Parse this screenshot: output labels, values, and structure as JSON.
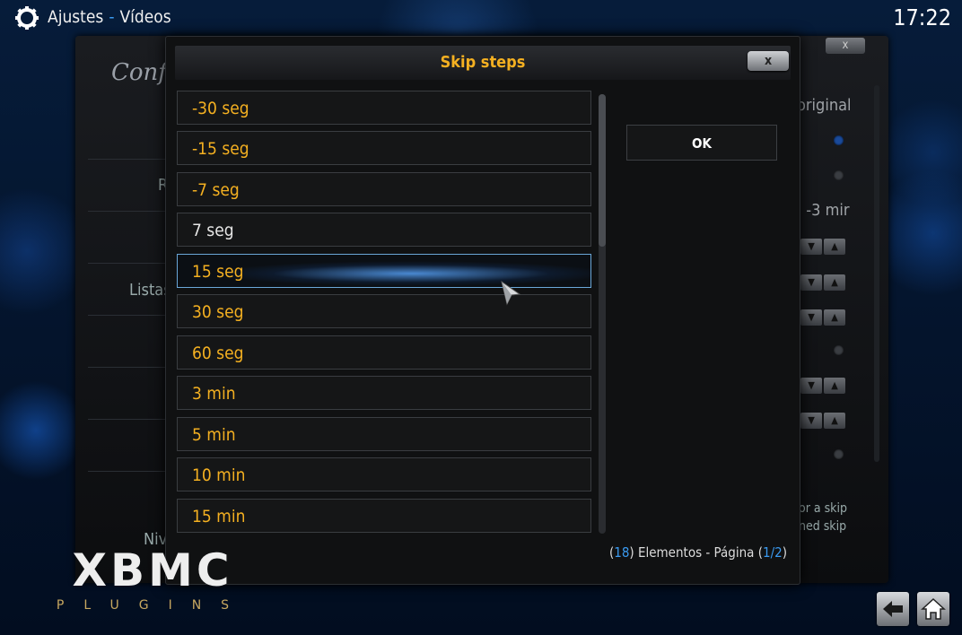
{
  "header": {
    "section": "Ajustes",
    "separator": "-",
    "subsection": "Vídeos",
    "time": "17:22"
  },
  "background_window": {
    "logo_text": "Conf",
    "left_labels": [
      "R",
      "Listas",
      "Niv"
    ],
    "right_texts": {
      "original": "original",
      "skip_value": ", -3 mir",
      "desc_line1": "or a skip",
      "desc_line2": "ned skip"
    },
    "close_label": "x"
  },
  "dialog": {
    "title": "Skip steps",
    "close_label": "x",
    "ok_label": "OK",
    "items": [
      {
        "label": "-30 seg",
        "state": "selected"
      },
      {
        "label": "-15 seg",
        "state": "selected"
      },
      {
        "label": "-7 seg",
        "state": "selected"
      },
      {
        "label": "7 seg",
        "state": "unselected"
      },
      {
        "label": "15 seg",
        "state": "focused"
      },
      {
        "label": "30 seg",
        "state": "selected"
      },
      {
        "label": "60 seg",
        "state": "selected"
      },
      {
        "label": "3 min",
        "state": "selected"
      },
      {
        "label": "5 min",
        "state": "selected"
      },
      {
        "label": "10 min",
        "state": "selected"
      },
      {
        "label": "15 min",
        "state": "selected"
      }
    ],
    "footer": {
      "open_paren": "(",
      "count": "18",
      "elements_text": ") Elementos - Página (",
      "page": "1/2",
      "close_paren": ")"
    }
  },
  "branding": {
    "logo_main": "XBMC",
    "logo_sub": "PLUGINS"
  },
  "colors": {
    "accent_orange": "#f4b021",
    "accent_blue": "#3a9af0",
    "panel_bg": "#101112"
  },
  "icons": {
    "settings": "gear-icon",
    "back": "back-arrow-icon",
    "home": "home-icon",
    "pointer": "mouse-cursor-icon"
  }
}
